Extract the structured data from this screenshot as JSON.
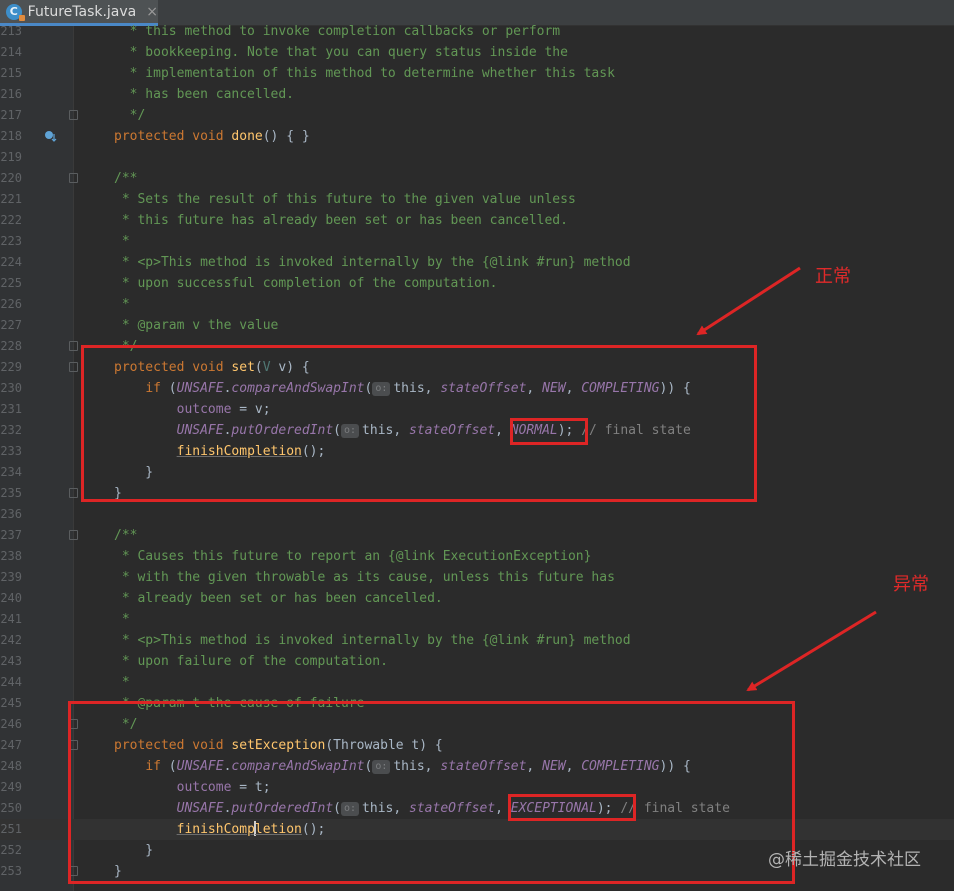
{
  "tab": {
    "icon_letter": "C",
    "icon": "java-class-icon",
    "title": "FutureTask.java",
    "close": "×"
  },
  "gutter_icons": {
    "218": "override-method-icon"
  },
  "lines": [
    {
      "n": "213",
      "text": "  * this method to invoke completion callbacks or perform"
    },
    {
      "n": "214",
      "text": "  * bookkeeping. Note that you can query status inside the"
    },
    {
      "n": "215",
      "text": "  * implementation of this method to determine whether this task"
    },
    {
      "n": "216",
      "text": "  * has been cancelled."
    },
    {
      "n": "217",
      "text": "  */"
    },
    {
      "n": "218",
      "text": "protected void done() { }"
    },
    {
      "n": "219",
      "text": ""
    },
    {
      "n": "220",
      "text": "/**"
    },
    {
      "n": "221",
      "text": " * Sets the result of this future to the given value unless"
    },
    {
      "n": "222",
      "text": " * this future has already been set or has been cancelled."
    },
    {
      "n": "223",
      "text": " *"
    },
    {
      "n": "224",
      "text": " * <p>This method is invoked internally by the {@link #run} method"
    },
    {
      "n": "225",
      "text": " * upon successful completion of the computation."
    },
    {
      "n": "226",
      "text": " *"
    },
    {
      "n": "227",
      "text": " * @param v the value"
    },
    {
      "n": "228",
      "text": " */"
    },
    {
      "n": "229",
      "text": "protected void set(V v) {"
    },
    {
      "n": "230",
      "text": "    if (UNSAFE.compareAndSwapInt(o: this, stateOffset, NEW, COMPLETING)) {"
    },
    {
      "n": "231",
      "text": "        outcome = v;"
    },
    {
      "n": "232",
      "text": "        UNSAFE.putOrderedInt(o: this, stateOffset, NORMAL); // final state"
    },
    {
      "n": "233",
      "text": "        finishCompletion();"
    },
    {
      "n": "234",
      "text": "    }"
    },
    {
      "n": "235",
      "text": "}"
    },
    {
      "n": "236",
      "text": ""
    },
    {
      "n": "237",
      "text": "/**"
    },
    {
      "n": "238",
      "text": " * Causes this future to report an {@link ExecutionException}"
    },
    {
      "n": "239",
      "text": " * with the given throwable as its cause, unless this future has"
    },
    {
      "n": "240",
      "text": " * already been set or has been cancelled."
    },
    {
      "n": "241",
      "text": " *"
    },
    {
      "n": "242",
      "text": " * <p>This method is invoked internally by the {@link #run} method"
    },
    {
      "n": "243",
      "text": " * upon failure of the computation."
    },
    {
      "n": "244",
      "text": " *"
    },
    {
      "n": "245",
      "text": " * @param t the cause of failure"
    },
    {
      "n": "246",
      "text": " */"
    },
    {
      "n": "247",
      "text": "protected void setException(Throwable t) {"
    },
    {
      "n": "248",
      "text": "    if (UNSAFE.compareAndSwapInt(o: this, stateOffset, NEW, COMPLETING)) {"
    },
    {
      "n": "249",
      "text": "        outcome = t;"
    },
    {
      "n": "250",
      "text": "        UNSAFE.putOrderedInt(o: this, stateOffset, EXCEPTIONAL); // final state"
    },
    {
      "n": "251",
      "text": "        finishCompletion();"
    },
    {
      "n": "252",
      "text": "    }"
    },
    {
      "n": "253",
      "text": "}"
    }
  ],
  "annotations": {
    "normal_label": "正常",
    "exceptional_label": "异常",
    "color": "#dd2525"
  },
  "watermark": "@稀土掘金技术社区",
  "colors": {
    "background": "#2b2b2b",
    "gutter": "#313335",
    "comment": "#629755",
    "keyword": "#cc7832",
    "method": "#ffc66d",
    "constant": "#9876aa",
    "text": "#a9b7c6"
  }
}
